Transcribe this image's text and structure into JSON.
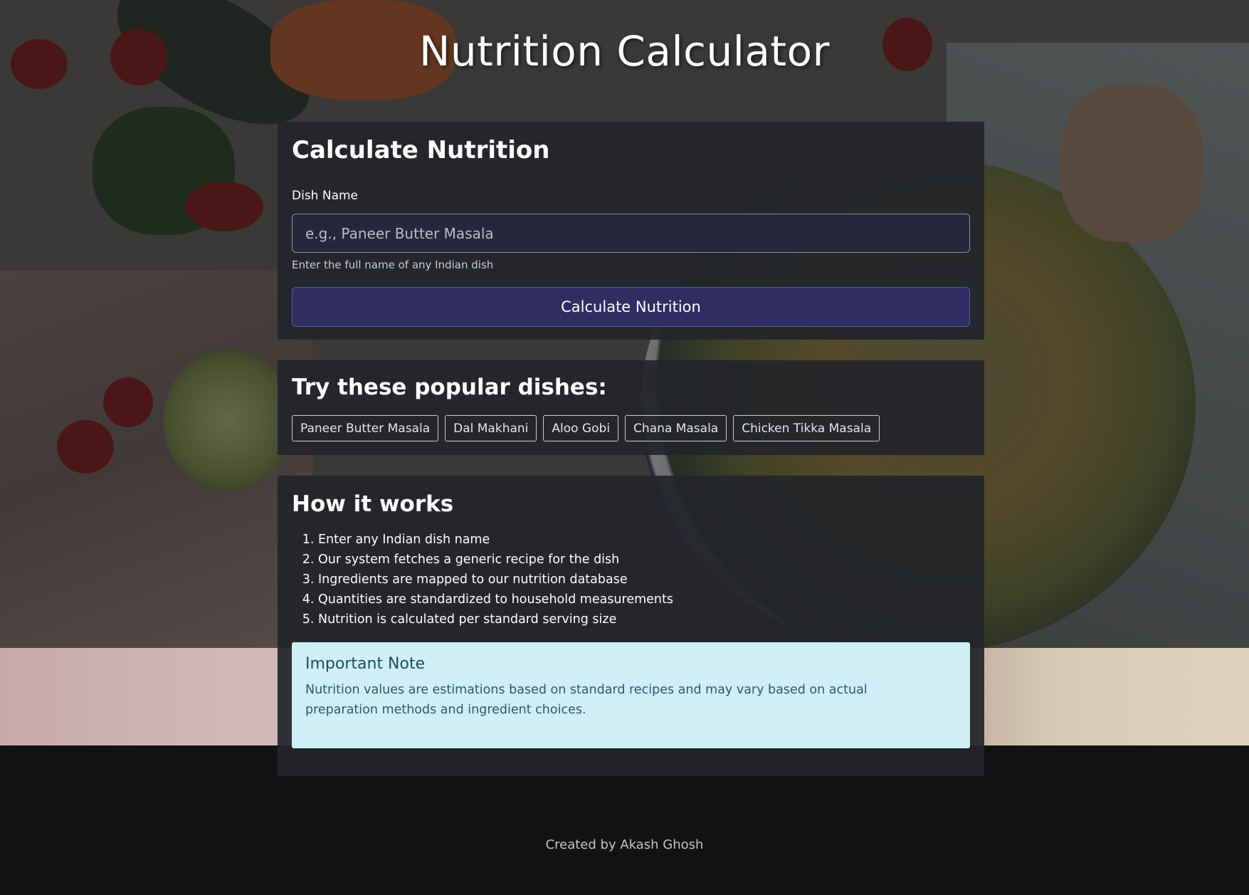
{
  "header": {
    "title": "Nutrition Calculator"
  },
  "calculator": {
    "heading": "Calculate Nutrition",
    "field_label": "Dish Name",
    "input_value": "",
    "input_placeholder": "e.g., Paneer Butter Masala",
    "hint": "Enter the full name of any Indian dish",
    "button_label": "Calculate Nutrition"
  },
  "popular": {
    "heading": "Try these popular dishes:",
    "dishes": [
      "Paneer Butter Masala",
      "Dal Makhani",
      "Aloo Gobi",
      "Chana Masala",
      "Chicken Tikka Masala"
    ]
  },
  "how_it_works": {
    "heading": "How it works",
    "steps": [
      "Enter any Indian dish name",
      "Our system fetches a generic recipe for the dish",
      "Ingredients are mapped to our nutrition database",
      "Quantities are standardized to household measurements",
      "Nutrition is calculated per standard serving size"
    ],
    "note": {
      "title": "Important Note",
      "text": "Nutrition values are estimations based on standard recipes and may vary based on actual preparation methods and ingredient choices."
    }
  },
  "footer": {
    "text": "Created by Akash Ghosh"
  },
  "colors": {
    "button_bg": "#2f2d62",
    "note_bg": "#cfeef6",
    "card_bg": "#22252a",
    "page_bg": "#121212"
  }
}
